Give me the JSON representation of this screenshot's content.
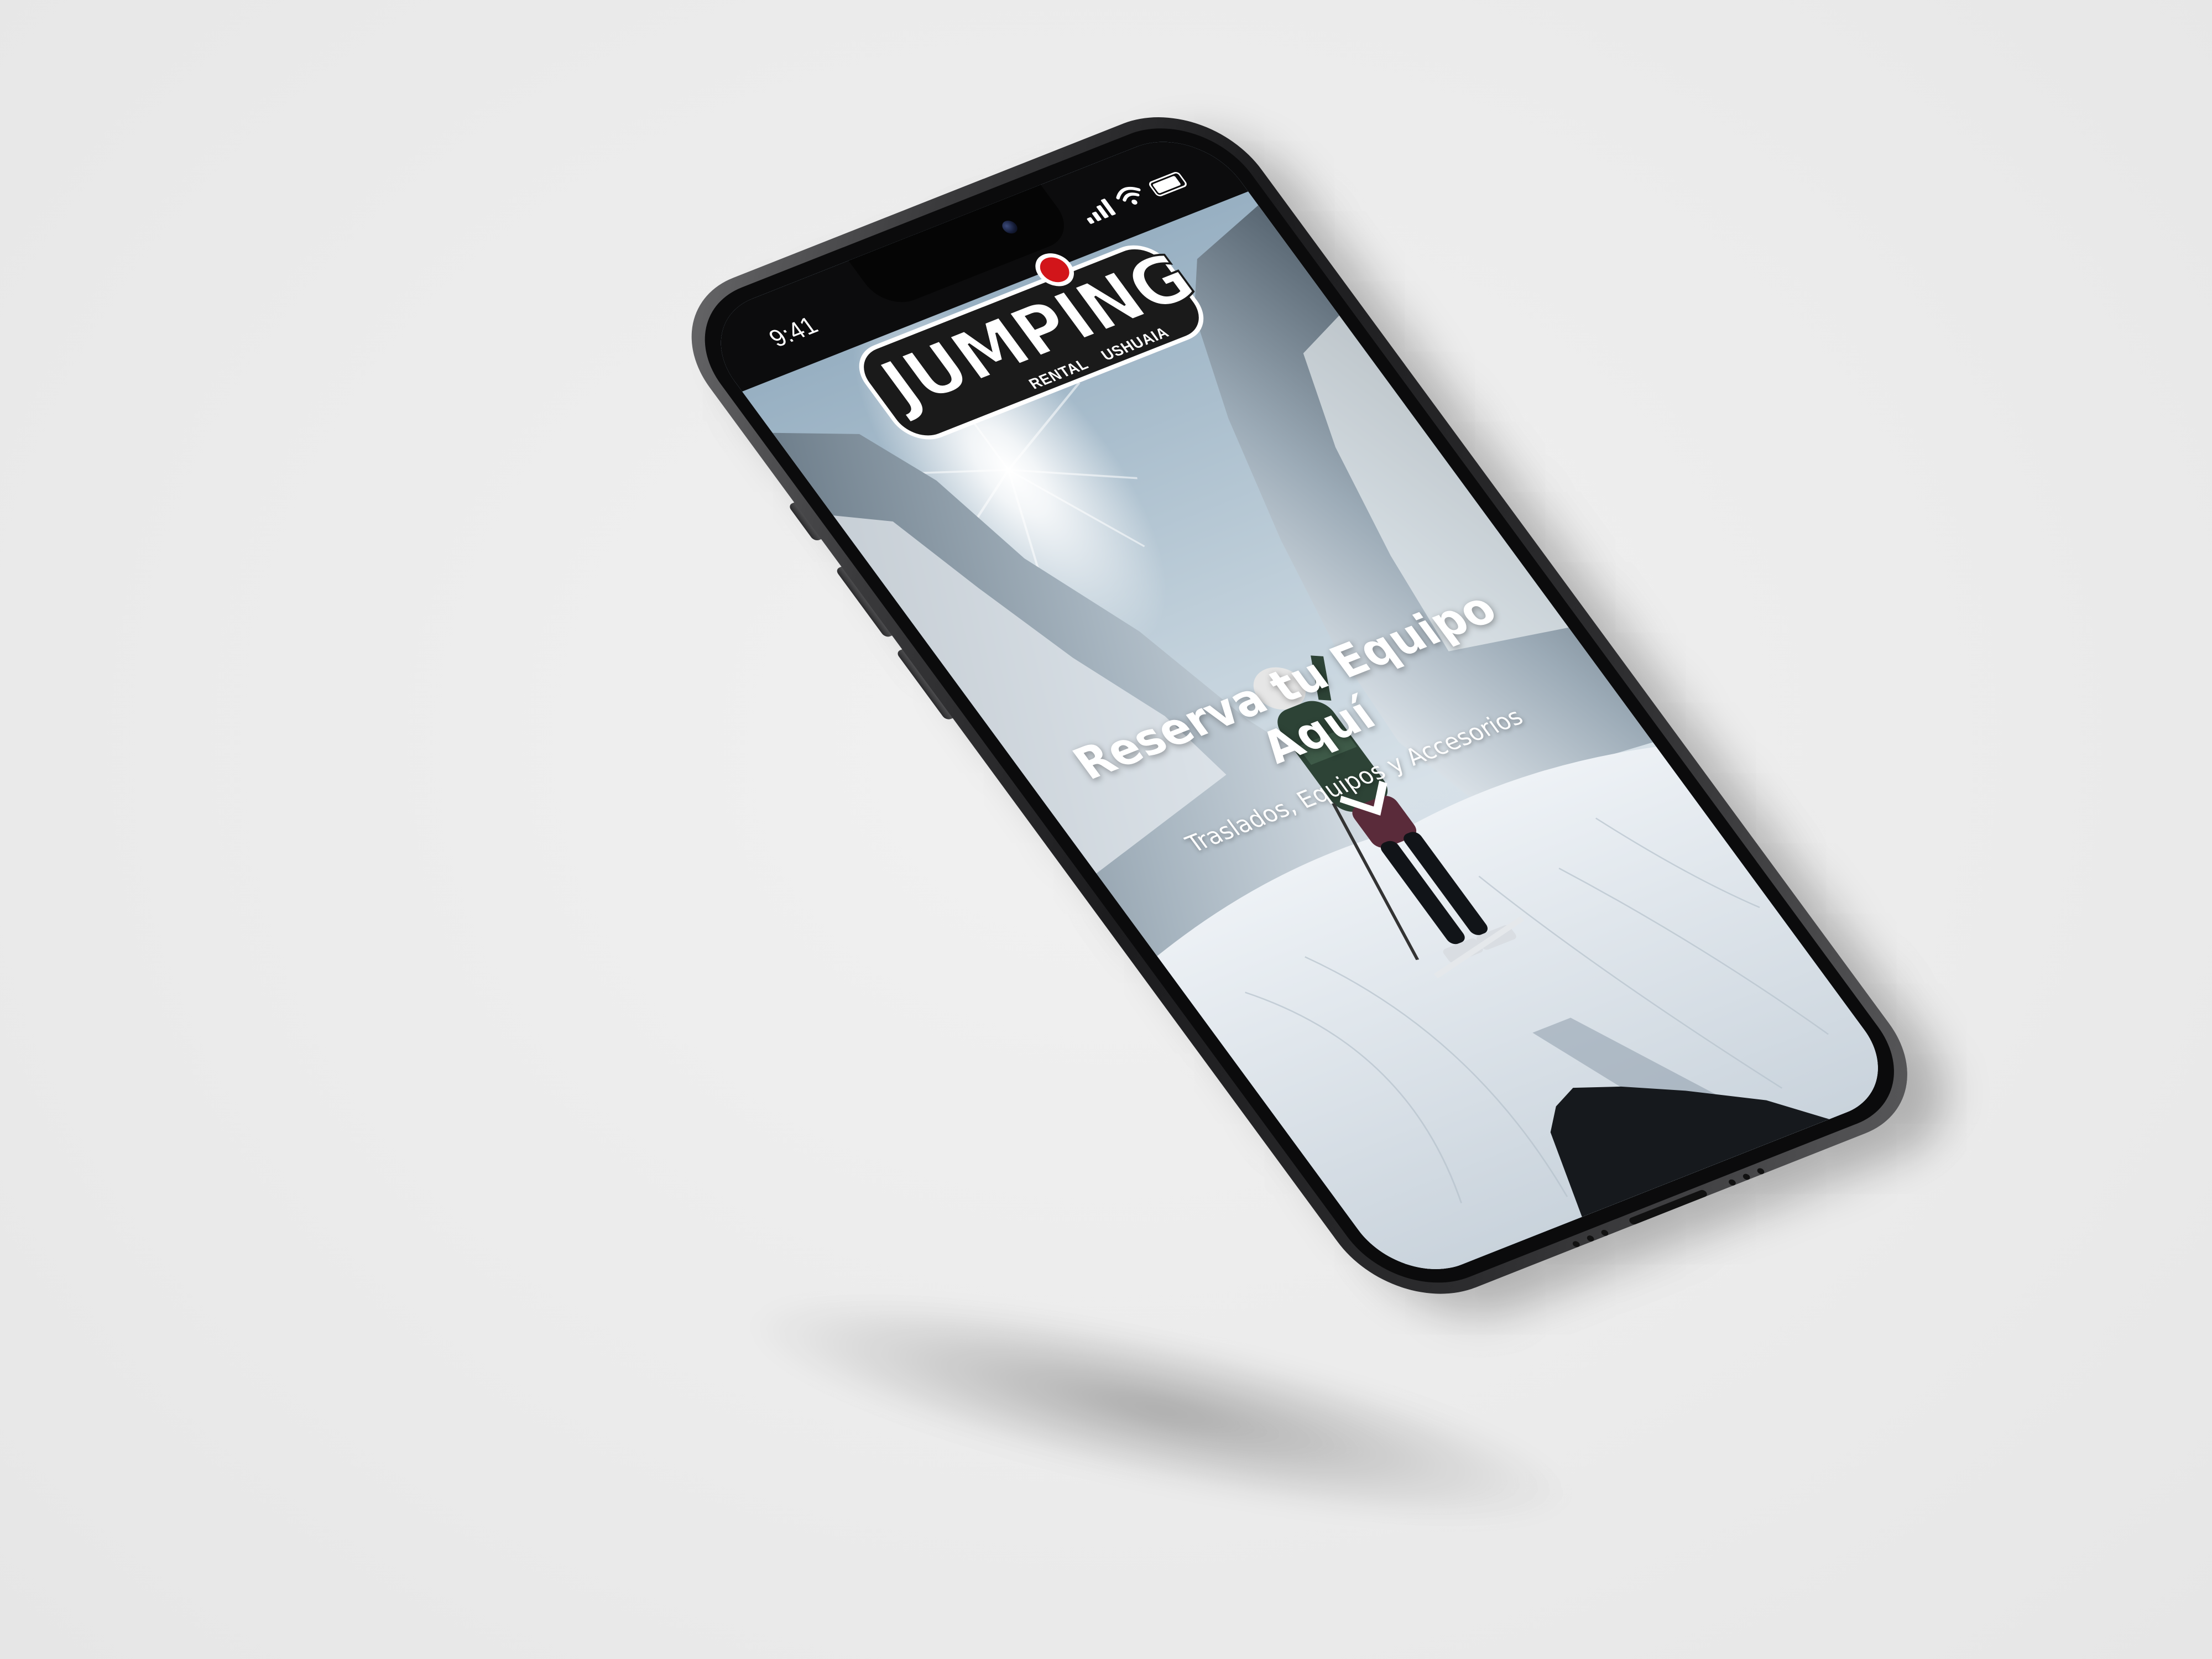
{
  "status_bar": {
    "time": "9:41",
    "icons": [
      "signal-icon",
      "wifi-icon",
      "battery-icon"
    ]
  },
  "logo": {
    "word": "JUMPING",
    "tagline_left": "RENTAL",
    "tagline_right": "USHUAIA",
    "dot_color": "#d2151a"
  },
  "hero": {
    "title": "Reserva tu Equipo Aquí",
    "subtitle": "Traslados, Equipos y Accesorios",
    "scroll_icon": "chevron-down-icon"
  },
  "colors": {
    "background": "#ececec",
    "phone_frame": "#1c1c1e",
    "text": "#ffffff"
  }
}
